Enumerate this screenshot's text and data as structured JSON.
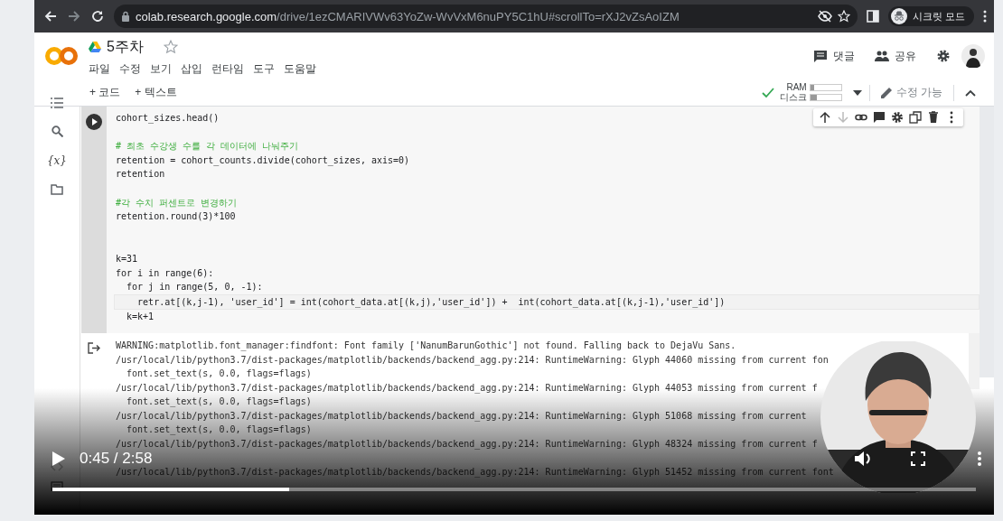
{
  "browser": {
    "host": "colab.research.google.com",
    "path": "/drive/1ezCMARIVWv63YoZw-WvVxM6nuPY5C1hU#scrollTo=rXJ2vZsAoIZM",
    "profile": "시크릿 모드"
  },
  "notebook": {
    "title": "5주차",
    "menu": [
      "파일",
      "수정",
      "보기",
      "삽입",
      "런타임",
      "도구",
      "도움말"
    ],
    "actions": [
      {
        "label": "댓글"
      },
      {
        "label": "공유"
      }
    ]
  },
  "toolbar": {
    "add_buttons": [
      "+ 코드",
      "+ 텍스트"
    ],
    "resources": [
      {
        "label": "RAM",
        "level": 0.12
      },
      {
        "label": "디스크",
        "level": 0.22
      }
    ],
    "edit_mode": "수정 가능"
  },
  "sidebar": {
    "variables": "{x}"
  },
  "cell": {
    "lines": [
      {
        "kind": "code",
        "text": "cohort_sizes.head()",
        "current": false
      },
      {
        "kind": "blank"
      },
      {
        "kind": "comment",
        "text": "# 최초 수강생 수를 각 데이터에 나눠주기",
        "current": false
      },
      {
        "kind": "code",
        "text": "retention = cohort_counts.divide(cohort_sizes, axis=0)",
        "current": false
      },
      {
        "kind": "code",
        "text": "retention",
        "current": false
      },
      {
        "kind": "blank"
      },
      {
        "kind": "comment",
        "text": "#각 수치 퍼센트로 변경하기",
        "current": false
      },
      {
        "kind": "code",
        "text": "retention.round(3)*100",
        "current": false
      },
      {
        "kind": "blank"
      },
      {
        "kind": "blank"
      },
      {
        "kind": "code",
        "text": "k=31",
        "current": false
      },
      {
        "kind": "code",
        "text": "for i in range(6):",
        "current": false
      },
      {
        "kind": "code",
        "text": "  for j in range(5, 0, -1):",
        "current": false
      },
      {
        "kind": "code",
        "text": "    retr.at[(k,j-1), 'user_id'] = int(cohort_data.at[(k,j),'user_id']) +  int(cohort_data.at[(k,j-1),'user_id'])",
        "current": true
      },
      {
        "kind": "code",
        "text": "  k=k+1",
        "current": false
      }
    ]
  },
  "output": {
    "lines": [
      {
        "kind": "text",
        "text": "WARNING:matplotlib.font_manager:findfont: Font family ['NanumBarunGothic'] not found. Falling back to DejaVu Sans."
      },
      {
        "kind": "text",
        "text": "/usr/local/lib/python3.7/dist-packages/matplotlib/backends/backend_agg.py:214: RuntimeWarning: Glyph 44060 missing from current fon"
      },
      {
        "kind": "text",
        "text": "  font.set_text(s, 0.0, flags=flags)"
      },
      {
        "kind": "text",
        "text": "/usr/local/lib/python3.7/dist-packages/matplotlib/backends/backend_agg.py:214: RuntimeWarning: Glyph 44053 missing from current f"
      },
      {
        "kind": "text",
        "text": "  font.set_text(s, 0.0, flags=flags)"
      },
      {
        "kind": "text",
        "text": "/usr/local/lib/python3.7/dist-packages/matplotlib/backends/backend_agg.py:214: RuntimeWarning: Glyph 51068 missing from current"
      },
      {
        "kind": "text",
        "text": "  font.set_text(s, 0.0, flags=flags)"
      },
      {
        "kind": "text",
        "text": "/usr/local/lib/python3.7/dist-packages/matplotlib/backends/backend_agg.py:214: RuntimeWarning: Glyph 48324 missing from current f"
      },
      {
        "kind": "blank"
      },
      {
        "kind": "text",
        "text": "/usr/local/lib/python3.7/dist-packages/matplotlib/backends/backend_agg.py:214: RuntimeWarning: Glyph 51452 missing from current font"
      }
    ]
  },
  "video": {
    "time": "0:45 / 2:58",
    "progress": {
      "level": 0.256
    }
  }
}
